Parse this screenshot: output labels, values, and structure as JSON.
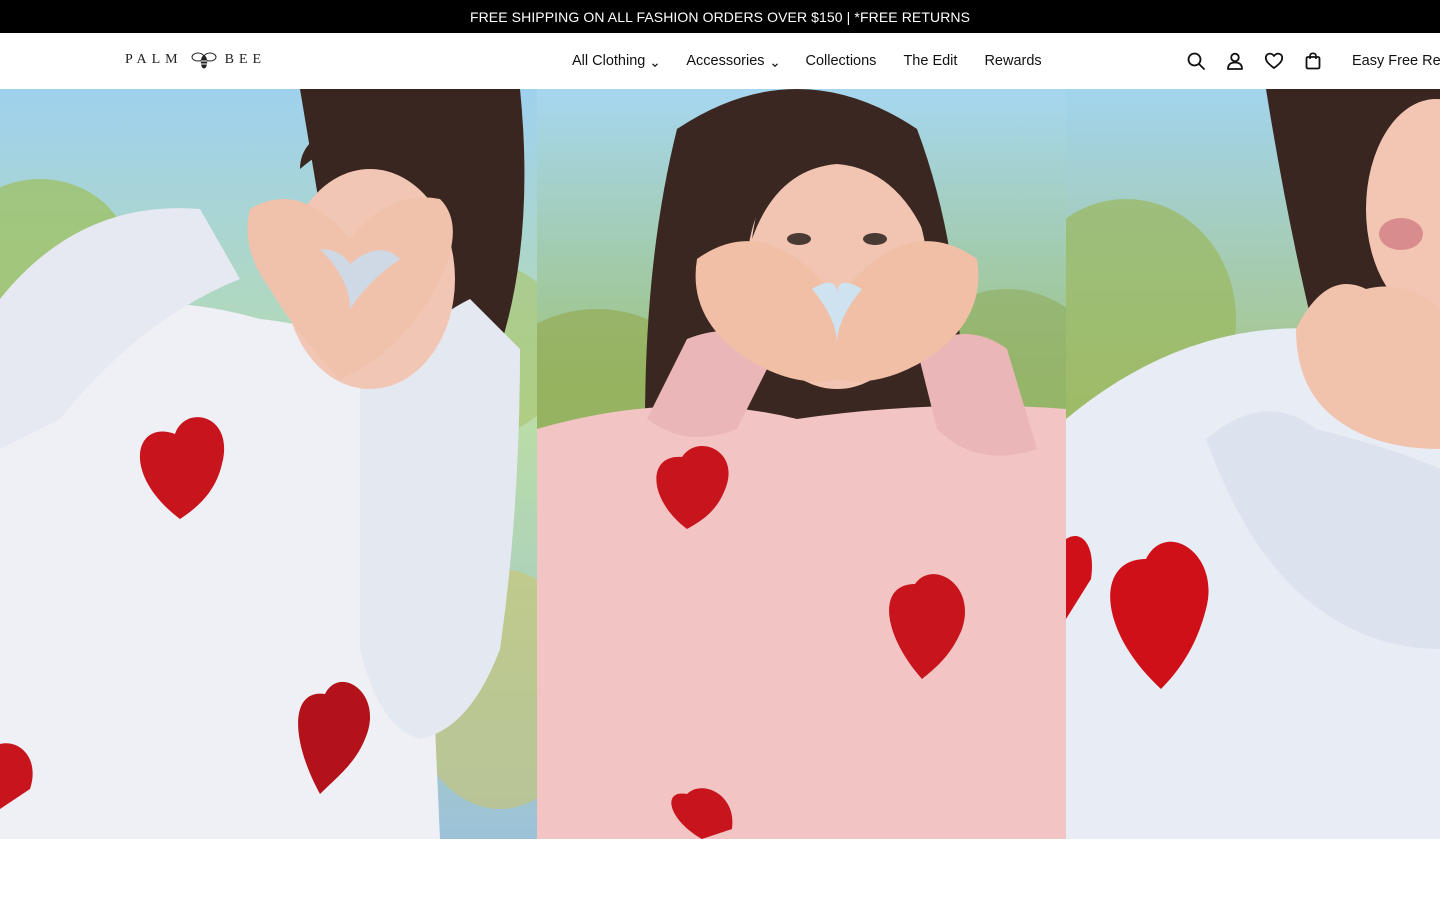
{
  "announcement": {
    "text": "FREE SHIPPING ON ALL FASHION ORDERS OVER $150 | *FREE RETURNS"
  },
  "header": {
    "logo_left": "PALM",
    "logo_right": "BEE",
    "nav": [
      {
        "label": "All Clothing",
        "has_dropdown": true
      },
      {
        "label": "Accessories",
        "has_dropdown": true
      },
      {
        "label": "Collections",
        "has_dropdown": false
      },
      {
        "label": "The Edit",
        "has_dropdown": false
      },
      {
        "label": "Rewards",
        "has_dropdown": false
      }
    ],
    "icons": [
      "search-icon",
      "account-icon",
      "wishlist-heart-icon",
      "cart-bag-icon"
    ],
    "promo_text": "Easy Free Retu"
  },
  "hero": {
    "panels": [
      {
        "name": "white-heart-sweater",
        "sweater_color": "#eef0f5",
        "heart_color": "#c8141c"
      },
      {
        "name": "pink-heart-sweater",
        "sweater_color": "#f2c4c4",
        "heart_color": "#c8141c"
      },
      {
        "name": "white-heart-sweater-blowing-kiss",
        "sweater_color": "#e8ecf4",
        "heart_color": "#d01018"
      }
    ]
  },
  "colors": {
    "announcement_bg": "#000000",
    "header_bg": "#ffffff",
    "text": "#111111"
  }
}
